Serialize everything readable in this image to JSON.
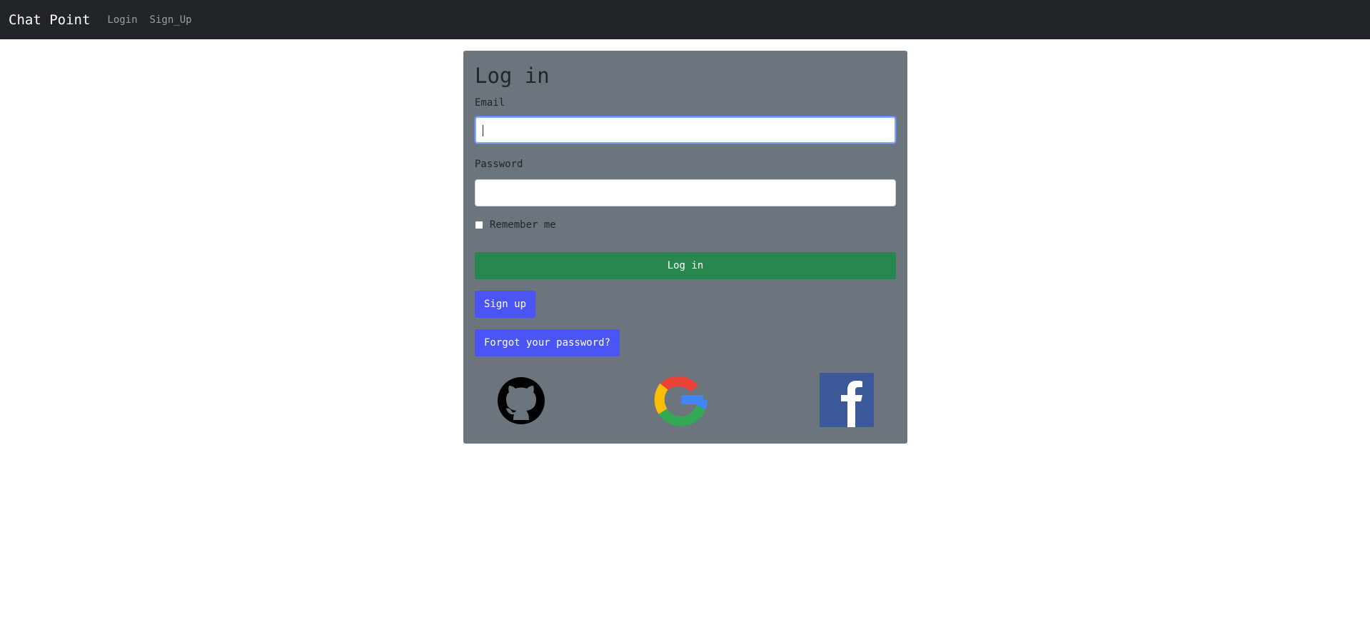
{
  "navbar": {
    "brand": "Chat Point",
    "links": [
      "Login",
      "Sign_Up"
    ]
  },
  "form": {
    "title": "Log in",
    "email_label": "Email",
    "email_value": "",
    "password_label": "Password",
    "password_value": "",
    "remember_label": "Remember me",
    "remember_checked": false,
    "login_button": "Log in",
    "signup_button": "Sign up",
    "forgot_button": "Forgot your password?"
  },
  "social": {
    "icons": [
      "github-icon",
      "google-icon",
      "facebook-icon"
    ]
  },
  "colors": {
    "navbar_bg": "#212529",
    "card_bg": "#6c757d",
    "login_button_bg": "#28874f",
    "secondary_button_bg": "#4b55f5",
    "facebook_blue": "#3b5998"
  }
}
